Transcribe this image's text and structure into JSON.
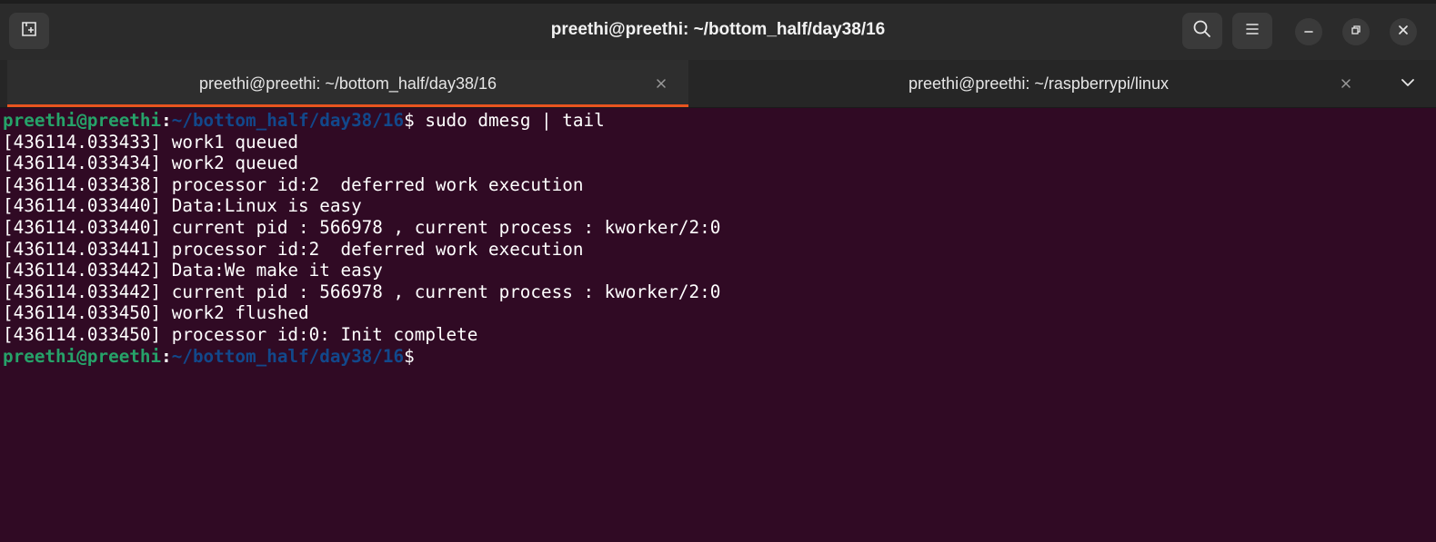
{
  "window": {
    "title": "preethi@preethi: ~/bottom_half/day38/16"
  },
  "tabs": [
    {
      "label": "preethi@preethi: ~/bottom_half/day38/16",
      "active": true
    },
    {
      "label": "preethi@preethi: ~/raspberrypi/linux",
      "active": false
    }
  ],
  "icons": {
    "new_tab": "new-tab-icon",
    "search": "search-icon",
    "menu": "hamburger-menu-icon",
    "minimize": "minimize-icon",
    "restore": "restore-icon",
    "close": "close-icon",
    "tab_close": "close-icon",
    "tabs_dropdown": "chevron-down-icon"
  },
  "colors": {
    "terminal_bg": "#300a24",
    "prompt_user": "#26a269",
    "prompt_path": "#12488b",
    "accent": "#e95420"
  },
  "terminal": {
    "prompt1": {
      "user_host": "preethi@preethi",
      "colon": ":",
      "path": "~/bottom_half/day38/16",
      "dollar": "$",
      "command": " sudo dmesg | tail"
    },
    "output": [
      "[436114.033433] work1 queued",
      "[436114.033434] work2 queued",
      "[436114.033438] processor id:2  deferred work execution",
      "[436114.033440] Data:Linux is easy",
      "[436114.033440] current pid : 566978 , current process : kworker/2:0",
      "[436114.033441] processor id:2  deferred work execution",
      "[436114.033442] Data:We make it easy",
      "[436114.033442] current pid : 566978 , current process : kworker/2:0",
      "[436114.033450] work2 flushed",
      "[436114.033450] processor id:0: Init complete"
    ],
    "prompt2": {
      "user_host": "preethi@preethi",
      "colon": ":",
      "path": "~/bottom_half/day38/16",
      "dollar": "$"
    }
  }
}
